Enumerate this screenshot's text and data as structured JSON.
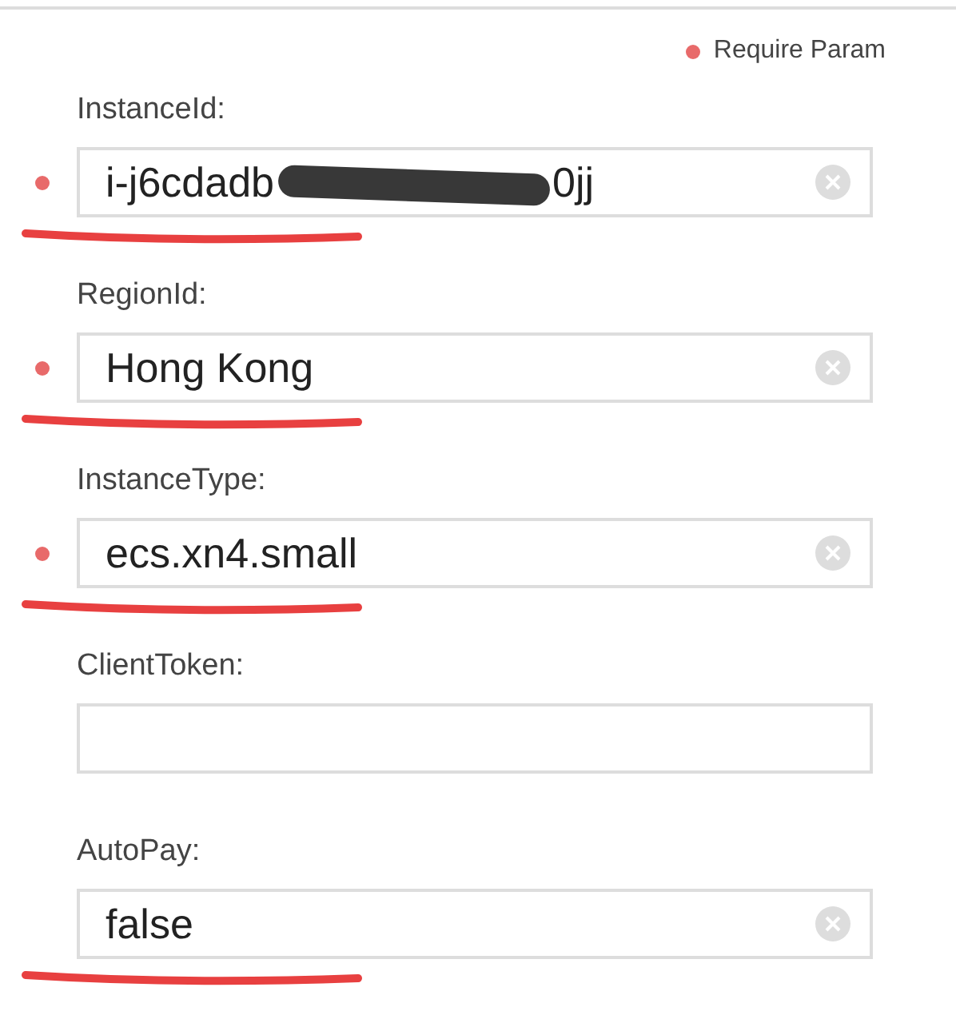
{
  "legend": {
    "label": "Require Param"
  },
  "params": [
    {
      "label": "InstanceId:",
      "required": true,
      "value": "i-j6cdadb",
      "redacted": true,
      "value_tail": "0jj",
      "underlined": true
    },
    {
      "label": "RegionId:",
      "required": true,
      "value": "Hong Kong",
      "underlined": true
    },
    {
      "label": "InstanceType:",
      "required": true,
      "value": "ecs.xn4.small",
      "underlined": true
    },
    {
      "label": "ClientToken:",
      "required": false,
      "underlined": false
    },
    {
      "label": "AutoPay:",
      "required": false,
      "value": "false",
      "underlined": true
    }
  ]
}
